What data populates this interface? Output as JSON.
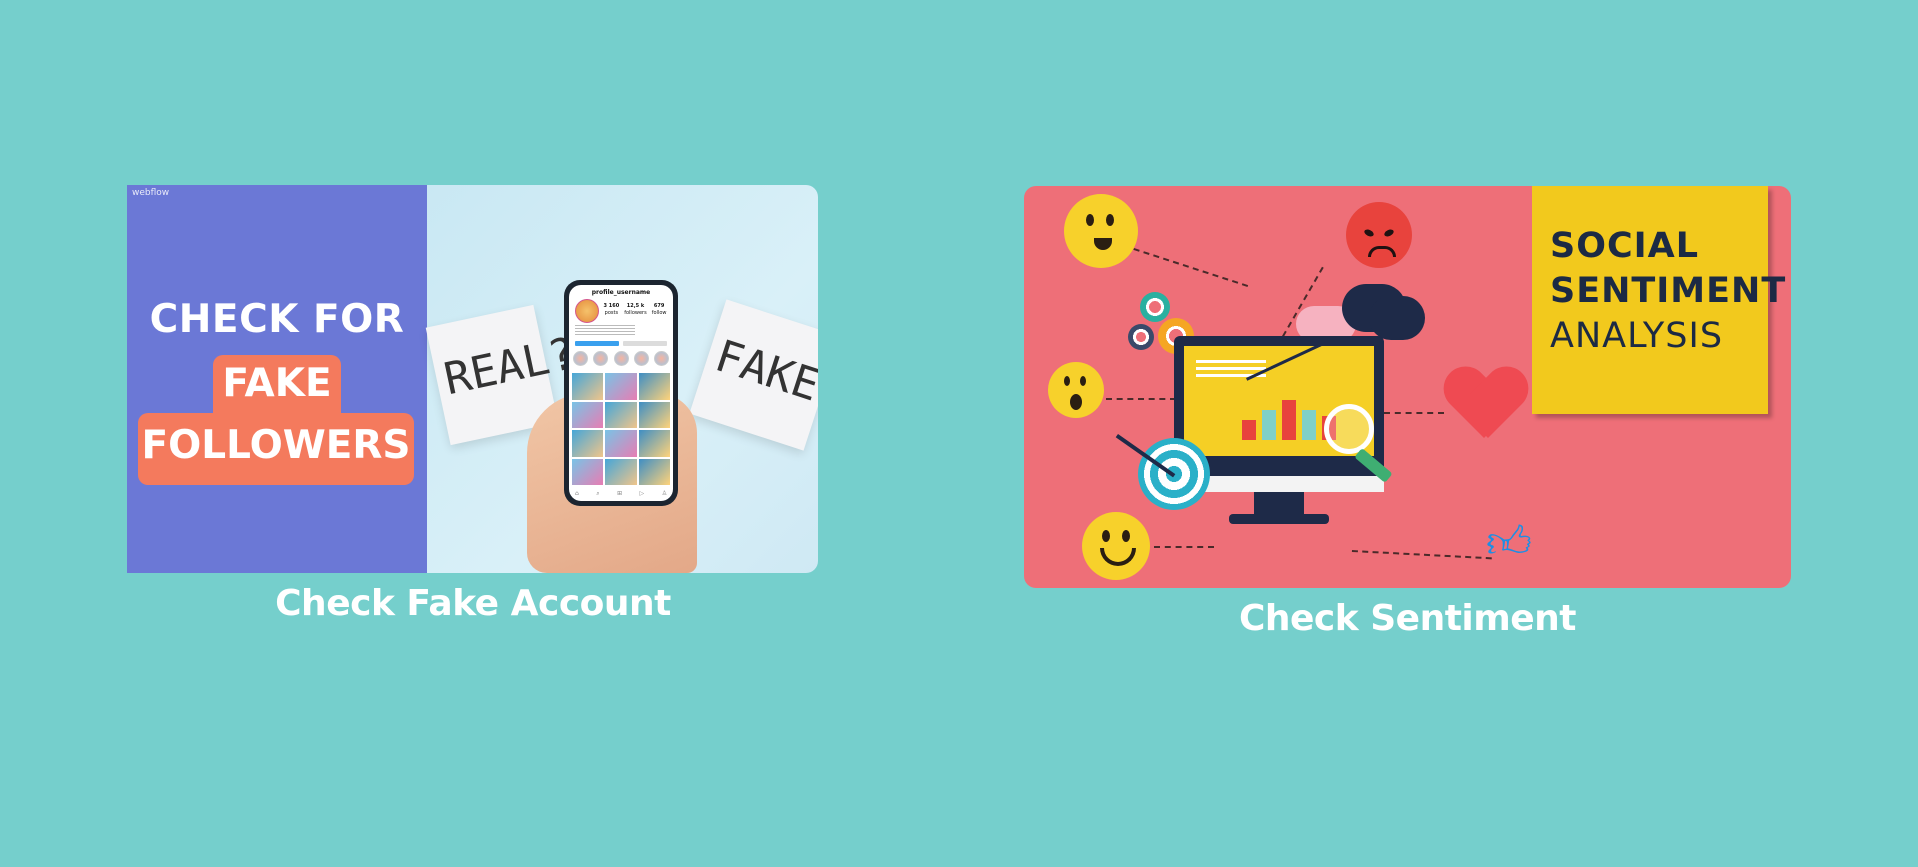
{
  "cards": [
    {
      "title": "Check Fake Account",
      "image": {
        "watermark": "webflow",
        "headline": "CHECK FOR",
        "highlight_line1": "FAKE",
        "highlight_line2": "FOLLOWERS",
        "note_left": "REAL?",
        "note_right": "FAKE?",
        "phone": {
          "username": "profile_username",
          "stats": [
            {
              "value": "3 160",
              "label": "posts"
            },
            {
              "value": "12,5 k",
              "label": "followers"
            },
            {
              "value": "679",
              "label": "follow"
            }
          ],
          "nav_icons": [
            "⌂",
            "⌕",
            "⊞",
            "▷",
            "♙"
          ]
        },
        "colors": {
          "left_panel": "#6b78d6",
          "highlight": "#f47a5d"
        }
      }
    },
    {
      "title": "Check Sentiment",
      "image": {
        "sticky_line1": "SOCIAL",
        "sticky_line2": "SENTIMENT",
        "sticky_line3": "ANALYSIS",
        "colors": {
          "background": "#ee6f78",
          "sticky": "#f2c91d"
        },
        "icons": [
          "smiley-happy-icon",
          "smiley-surprised-icon",
          "smiley-smile-icon",
          "angry-face-icon",
          "cloud-icon",
          "gear-icon",
          "monitor-chart-icon",
          "target-icon",
          "magnifier-icon",
          "heart-icon",
          "thumbs-up-icon"
        ]
      }
    }
  ],
  "background_color": "#75cfcc"
}
